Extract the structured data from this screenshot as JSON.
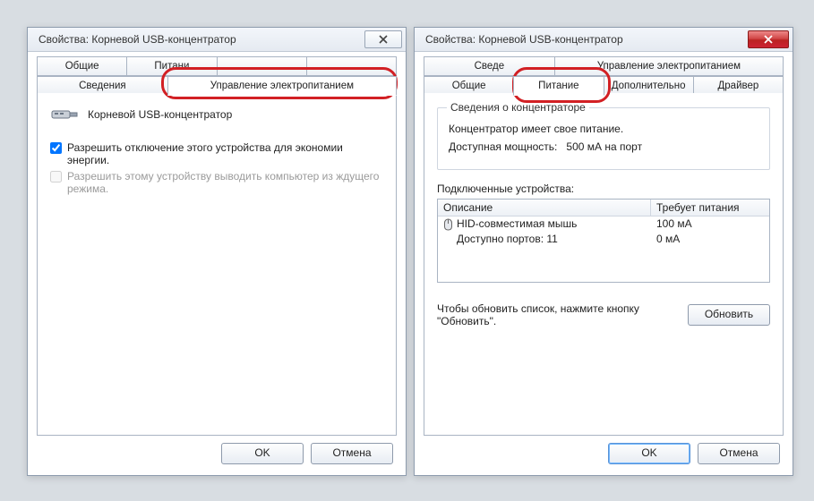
{
  "left": {
    "title": "Свойства: Корневой USB-концентратор",
    "tabs_row1": [
      "Общие",
      "Питани",
      "",
      ""
    ],
    "tabs_row2": [
      "Сведения",
      "Управление электропитанием"
    ],
    "active_tab": "Управление электропитанием",
    "device_name": "Корневой USB-концентратор",
    "chk1_label": "Разрешить отключение этого устройства для экономии энергии.",
    "chk1_checked": true,
    "chk2_label": "Разрешить этому устройству выводить компьютер из ждущего режима.",
    "chk2_checked": false,
    "chk2_disabled": true,
    "ok": "OK",
    "cancel": "Отмена"
  },
  "right": {
    "title": "Свойства: Корневой USB-концентратор",
    "tabs_row1": [
      "Сведе",
      "Управление электропитанием"
    ],
    "tabs_row2": [
      "Общие",
      "Питание",
      "Дополнительно",
      "Драйвер"
    ],
    "active_tab": "Питание",
    "group_legend": "Сведения о концентраторе",
    "info1": "Концентратор имеет свое питание.",
    "info2_label": "Доступная мощность:",
    "info2_value": "500 мА на порт",
    "dev_list_label": "Подключенные устройства:",
    "hdr_desc": "Описание",
    "hdr_power": "Требует питания",
    "rows": [
      {
        "name": "HID-совместимая мышь",
        "power": "100 мА",
        "icon": "mouse"
      },
      {
        "name": "Доступно портов: 11",
        "power": "0 мА",
        "icon": ""
      }
    ],
    "refresh_hint": "Чтобы обновить список, нажмите кнопку \"Обновить\".",
    "refresh": "Обновить",
    "ok": "OK",
    "cancel": "Отмена"
  }
}
